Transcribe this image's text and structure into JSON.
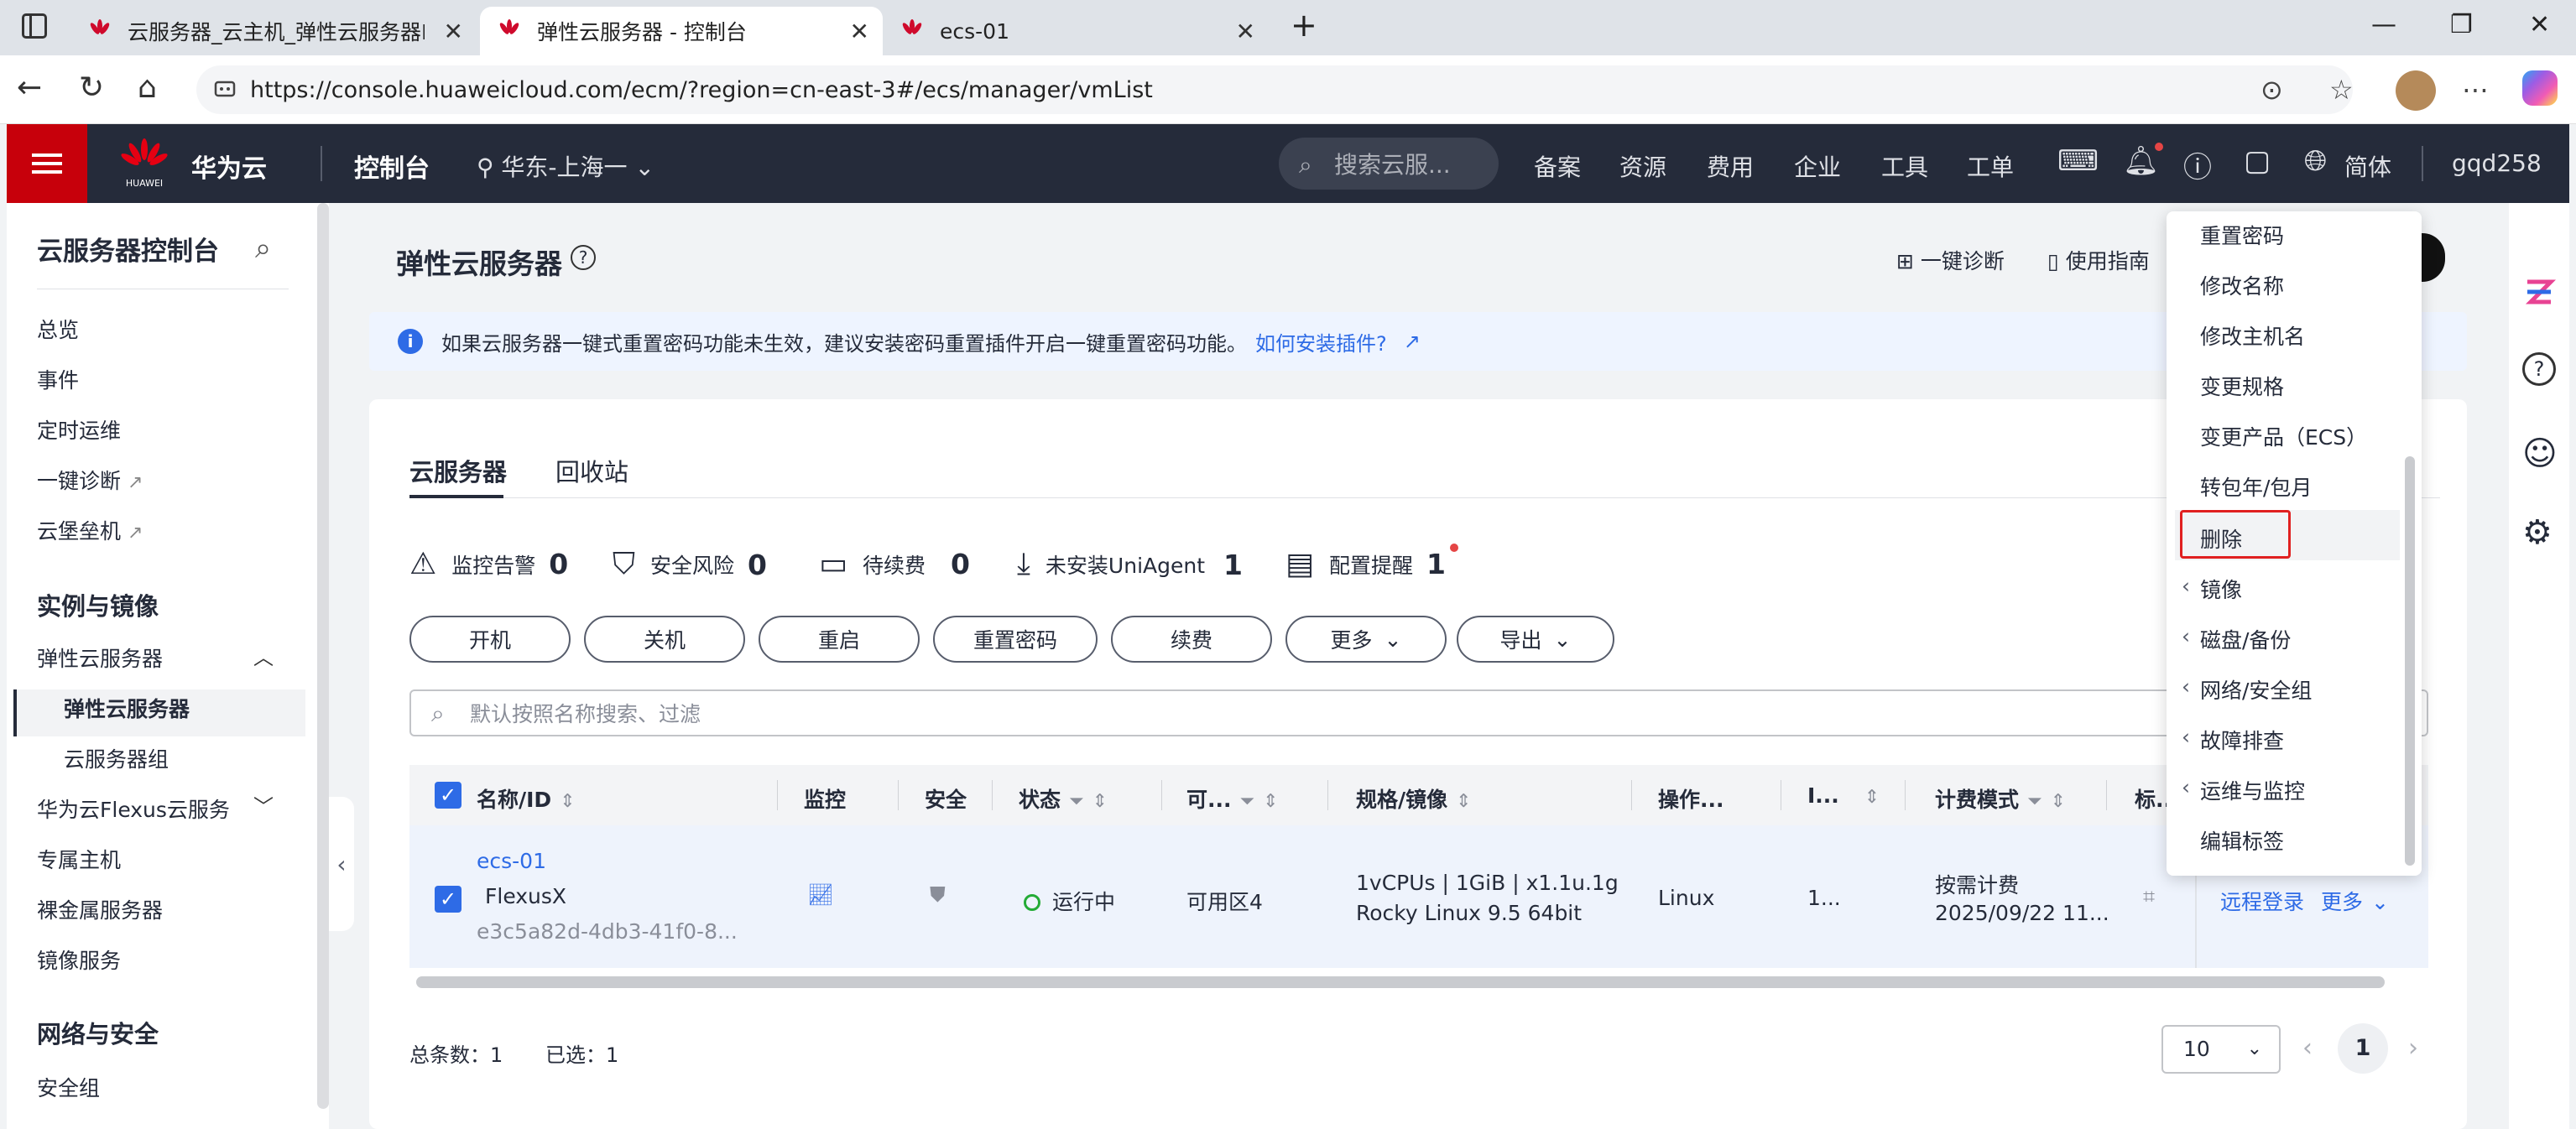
{
  "browser": {
    "tabs": [
      {
        "title": "云服务器_云主机_弹性云服务器EC",
        "active": false
      },
      {
        "title": "弹性云服务器 - 控制台",
        "active": true
      },
      {
        "title": "ecs-01",
        "active": false
      }
    ],
    "url": "https://console.huaweicloud.com/ecm/?region=cn-east-3#/ecs/manager/vmList"
  },
  "topnav": {
    "brand": "华为云",
    "brand_small": "HUAWEI",
    "console": "控制台",
    "region": "华东-上海一",
    "search_placeholder": "搜索云服...",
    "links": [
      "备案",
      "资源",
      "费用",
      "企业",
      "工具",
      "工单"
    ],
    "language": "简体",
    "username": "gqd258"
  },
  "sidebar": {
    "title": "云服务器控制台",
    "items": [
      {
        "label": "总览"
      },
      {
        "label": "事件"
      },
      {
        "label": "定时运维"
      },
      {
        "label": "一键诊断"
      },
      {
        "label": "云堡垒机"
      }
    ],
    "group_instances": "实例与镜像",
    "ecs_parent": "弹性云服务器",
    "ecs_sub": [
      "弹性云服务器",
      "云服务器组"
    ],
    "more_items": [
      "华为云Flexus云服务",
      "专属主机",
      "裸金属服务器",
      "镜像服务"
    ],
    "group_network": "网络与安全",
    "network_items": [
      "安全组"
    ]
  },
  "main": {
    "title": "弹性云服务器",
    "header_links": [
      "一键诊断",
      "使用指南"
    ],
    "banner_text": "如果云服务器一键式重置密码功能未生效，建议安装密码重置插件开启一键重置密码功能。",
    "banner_link": "如何安装插件?",
    "tabs": [
      "云服务器",
      "回收站"
    ],
    "stats": [
      {
        "label": "监控告警",
        "value": "0"
      },
      {
        "label": "安全风险",
        "value": "0"
      },
      {
        "label": "待续费",
        "value": "0"
      },
      {
        "label": "未安装UniAgent",
        "value": "1"
      },
      {
        "label": "配置提醒",
        "value": "1"
      }
    ],
    "buttons": [
      "开机",
      "关机",
      "重启",
      "重置密码",
      "续费",
      "更多",
      "导出"
    ],
    "filter_placeholder": "默认按照名称搜索、过滤",
    "columns": [
      "名称/ID",
      "监控",
      "安全",
      "状态",
      "可...",
      "规格/镜像",
      "操作...",
      "I...",
      "计费模式",
      "标..."
    ],
    "row": {
      "name": "ecs-01",
      "type": "FlexusX",
      "id": "e3c5a82d-4db3-41f0-8...",
      "status": "运行中",
      "az": "可用区4",
      "spec": "1vCPUs | 1GiB | x1.1u.1g",
      "image": "Rocky Linux 9.5 64bit",
      "os": "Linux",
      "ip": "1...",
      "billing": "按需计费",
      "billing_date": "2025/09/22 11...",
      "op_remote": "远程登录",
      "op_more": "更多"
    },
    "footer": {
      "total": "总条数：1",
      "selected": "已选：1",
      "page_size": "10",
      "current_page": "1"
    }
  },
  "dropdown": {
    "items": [
      {
        "label": "重置密码",
        "submenu": false
      },
      {
        "label": "修改名称",
        "submenu": false
      },
      {
        "label": "修改主机名",
        "submenu": false
      },
      {
        "label": "变更规格",
        "submenu": false
      },
      {
        "label": "变更产品（ECS）",
        "submenu": false
      },
      {
        "label": "转包年/包月",
        "submenu": false
      },
      {
        "label": "删除",
        "submenu": false
      },
      {
        "label": "镜像",
        "submenu": true
      },
      {
        "label": "磁盘/备份",
        "submenu": true
      },
      {
        "label": "网络/安全组",
        "submenu": true
      },
      {
        "label": "故障排查",
        "submenu": true
      },
      {
        "label": "运维与监控",
        "submenu": true
      },
      {
        "label": "编辑标签",
        "submenu": false
      }
    ],
    "highlighted": "删除"
  },
  "colors": {
    "brand_red": "#c7000b",
    "nav_dark": "#252b3a",
    "link_blue": "#2e6be6",
    "running_green": "#24ab36",
    "highlight_red": "#e02020"
  }
}
